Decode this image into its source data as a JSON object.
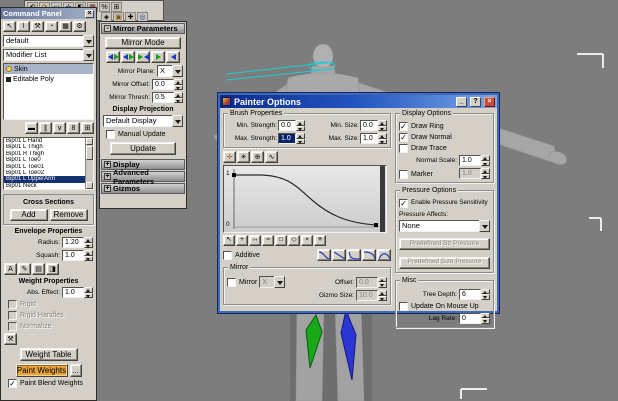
{
  "glyphs": {
    "check": "✓",
    "close": "×",
    "help": "?",
    "minimize": "_",
    "rollout_open": "-",
    "rollout_closed": "+"
  },
  "top_toolbar": {
    "icons": [
      "⟲",
      "⟳",
      "▭",
      "✛",
      "◧",
      "▦",
      "%",
      "⊞"
    ],
    "icons2": [
      "◈",
      "▣",
      "✚",
      "◎"
    ]
  },
  "command_panel": {
    "title": "Command Panel",
    "tab_icons": [
      "↖",
      "⌇",
      "⚒",
      "◔",
      "▦",
      "⚙"
    ],
    "preset": "default",
    "modifier_list": "Modifier List",
    "stack": {
      "skin": "Skin",
      "editable_poly": "Editable Poly"
    },
    "stack_buttons": [
      "▬",
      "∥",
      "∨",
      "8",
      "⊞"
    ],
    "bones": [
      "Bip01 L Hand",
      "Bip01 L Thigh",
      "Bip01 R Thigh",
      "Bip01 L Toe0",
      "Bip01 L Toe01",
      "Bip01 L Toe02",
      "Bip01 L UpperArm",
      "Bip01 Neck"
    ],
    "cross_sections": {
      "title": "Cross Sections",
      "add": "Add",
      "remove": "Remove"
    },
    "envelope": {
      "title": "Envelope Properties",
      "radius_label": "Radius:",
      "radius": "1.20",
      "squash_label": "Squash:",
      "squash": "1.0",
      "buttons": [
        "A",
        "✎",
        "▤",
        "◨"
      ]
    },
    "weight": {
      "title": "Weight Properties",
      "abs_label": "Abs. Effect:",
      "abs_value": "1.0",
      "rigid": "Rigid",
      "rigid_handles": "Rigid Handles",
      "normalize": "Normalize",
      "tool_icon": "⚒",
      "weight_table": "Weight Table",
      "paint_weights": "Paint Weights",
      "options_dots": "...",
      "paint_blend": "Paint Blend Weights"
    }
  },
  "mirror_panel": {
    "title": "Mirror Parameters",
    "mirror_mode": "Mirror Mode",
    "plane_label": "Mirror Plane:",
    "plane": "X",
    "offset_label": "Mirror Offset:",
    "offset": "0.0",
    "thresh_label": "Mirror Thresh:",
    "thresh": "0.5",
    "display_projection": "Display Projection",
    "display_mode": "Default Display",
    "manual_update": "Manual Update",
    "update": "Update",
    "rollouts": [
      "Display",
      "Advanced Parameters",
      "Gizmos"
    ]
  },
  "painter": {
    "title": "Painter Options",
    "brush": {
      "title": "Brush Properties",
      "min_strength_label": "Min. Strength:",
      "min_strength": "0.0",
      "max_strength_label": "Max. Strength:",
      "max_strength": "1.0",
      "min_size_label": "Min. Size:",
      "min_size": "0.0",
      "max_size_label": "Max. Size:",
      "max_size": "1.0"
    },
    "falloff_tools": [
      "✛",
      "✳",
      "⊕",
      "∿"
    ],
    "graph": {
      "top": "1",
      "bottom": "0"
    },
    "curve_tools": [
      "↖",
      "+",
      "↔",
      "≈",
      "□",
      "◇",
      "×",
      "≡"
    ],
    "additive": "Additive",
    "mirror": {
      "title": "Mirror",
      "checkbox": "Mirror",
      "axis": "X",
      "offset_label": "Offset:",
      "offset": "0.0",
      "gizmo_label": "Gizmo Size:",
      "gizmo": "10.0"
    },
    "display": {
      "title": "Display Options",
      "draw_ring": "Draw Ring",
      "draw_normal": "Draw Normal",
      "draw_trace": "Draw Trace",
      "normal_scale_label": "Normal Scale:",
      "normal_scale": "1.0",
      "marker": "Marker",
      "marker_value": "1.0"
    },
    "pressure": {
      "title": "Pressure Options",
      "enable": "Enable Pressure Sensitivity",
      "affects_label": "Pressure Affects:",
      "affects": "None",
      "str_button": "Predefined Str Pressure",
      "size_button": "Predefined Size Pressure"
    },
    "misc": {
      "title": "Misc",
      "tree_depth_label": "Tree Depth:",
      "tree_depth": "6",
      "update_mouse": "Update On Mouse Up",
      "lag_label": "Lag Rate:",
      "lag": "0"
    }
  }
}
